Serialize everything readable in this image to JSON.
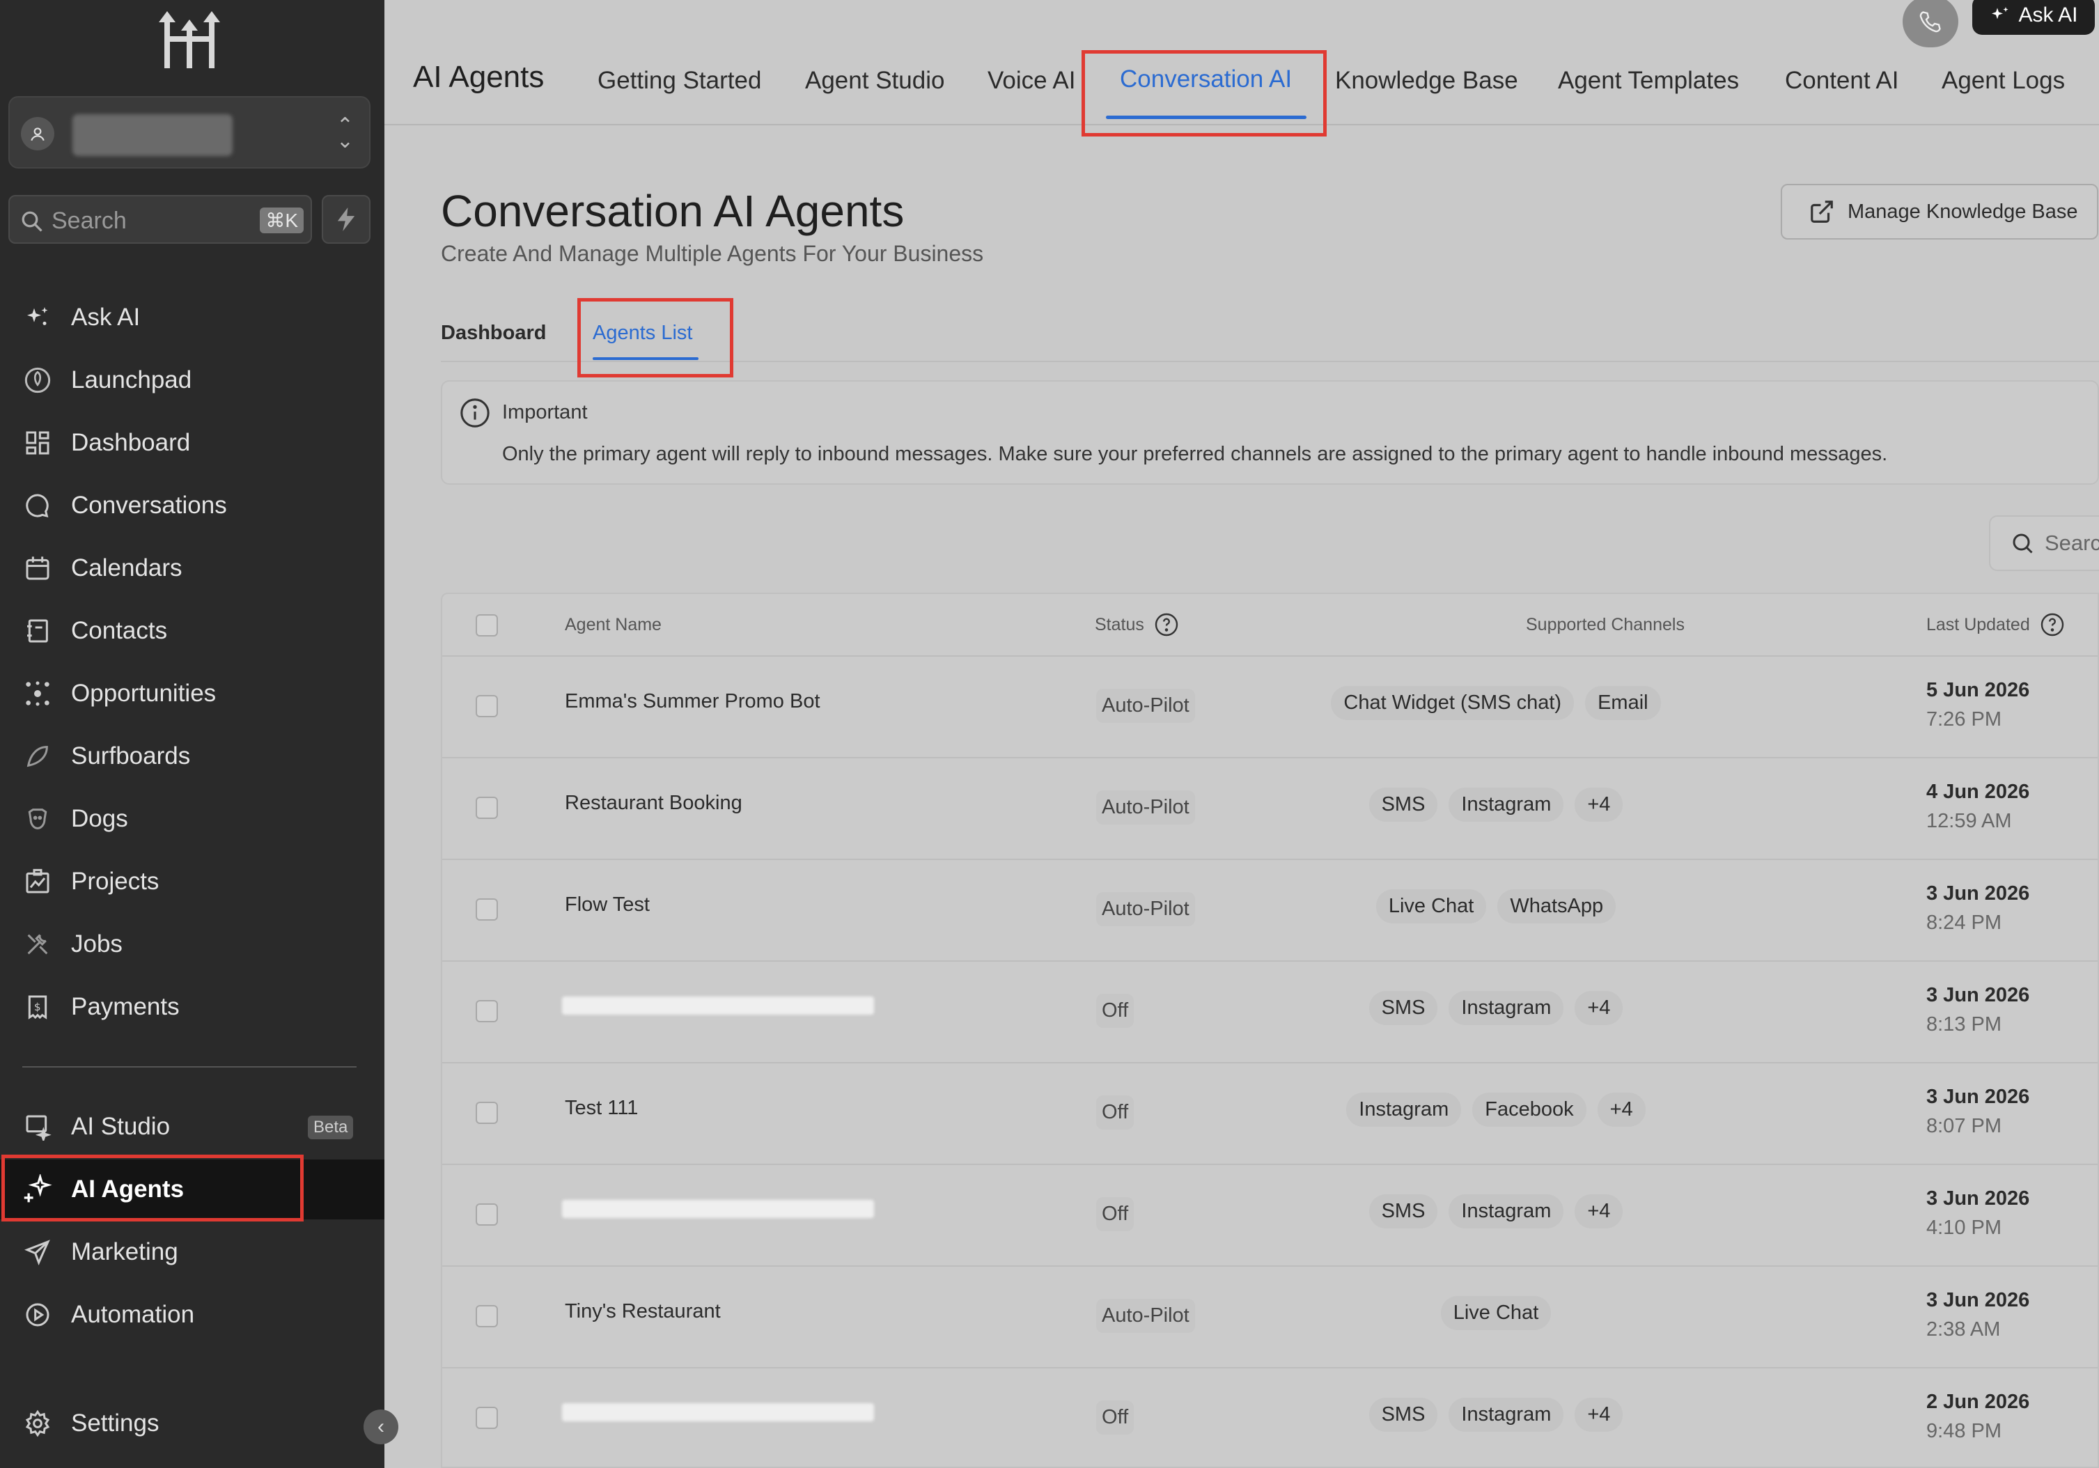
{
  "sidebar": {
    "search_placeholder": "Search",
    "search_shortcut": "⌘K",
    "items": [
      {
        "label": "Ask AI",
        "icon": "sparkle-icon"
      },
      {
        "label": "Launchpad",
        "icon": "rocket-icon"
      },
      {
        "label": "Dashboard",
        "icon": "dashboard-grid-icon"
      },
      {
        "label": "Conversations",
        "icon": "chat-bubble-icon"
      },
      {
        "label": "Calendars",
        "icon": "calendar-icon"
      },
      {
        "label": "Contacts",
        "icon": "contacts-book-icon"
      },
      {
        "label": "Opportunities",
        "icon": "opportunities-icon"
      },
      {
        "label": "Surfboards",
        "icon": "surfboard-icon"
      },
      {
        "label": "Dogs",
        "icon": "dog-icon"
      },
      {
        "label": "Projects",
        "icon": "projects-icon"
      },
      {
        "label": "Jobs",
        "icon": "tools-icon"
      },
      {
        "label": "Payments",
        "icon": "payments-icon"
      },
      {
        "label": "AI Studio",
        "icon": "ai-studio-icon"
      },
      {
        "label": "AI Agents",
        "icon": "ai-sparkle-icon"
      },
      {
        "label": "Marketing",
        "icon": "paper-plane-icon"
      },
      {
        "label": "Automation",
        "icon": "automation-icon"
      },
      {
        "label": "Settings",
        "icon": "gear-icon"
      }
    ],
    "beta_badge": "Beta",
    "active_item": "AI Agents"
  },
  "topbar": {
    "brand": "AI Agents",
    "tabs": [
      "Getting Started",
      "Agent Studio",
      "Voice AI",
      "Conversation AI",
      "Knowledge Base",
      "Agent Templates",
      "Content AI",
      "Agent Logs"
    ],
    "active_tab": "Conversation AI",
    "ask_ai_label": "Ask AI"
  },
  "main": {
    "title": "Conversation AI Agents",
    "subtitle": "Create And Manage Multiple Agents For Your Business",
    "manage_button": "Manage Knowledge Base",
    "subtabs": [
      "Dashboard",
      "Agents List"
    ],
    "active_subtab": "Agents List",
    "notice": {
      "title": "Important",
      "body": "Only the primary agent will reply to inbound messages. Make sure your preferred channels are assigned to the primary agent to handle inbound messages."
    },
    "table_search_placeholder": "Search"
  },
  "table": {
    "headers": {
      "name": "Agent Name",
      "status": "Status",
      "channels": "Supported Channels",
      "updated": "Last Updated"
    },
    "rows": [
      {
        "name": "Emma's Summer Promo Bot",
        "status": "Auto-Pilot",
        "channels": [
          "Chat Widget (SMS chat)",
          "Email"
        ],
        "date": "5 Jun 2026",
        "time": "7:26 PM"
      },
      {
        "name": "Restaurant Booking",
        "status": "Auto-Pilot",
        "channels": [
          "SMS",
          "Instagram",
          "+4"
        ],
        "date": "4 Jun 2026",
        "time": "12:59 AM"
      },
      {
        "name": "Flow Test",
        "status": "Auto-Pilot",
        "channels": [
          "Live Chat",
          "WhatsApp"
        ],
        "date": "3 Jun 2026",
        "time": "8:24 PM"
      },
      {
        "name": "",
        "status": "Off",
        "channels": [
          "SMS",
          "Instagram",
          "+4"
        ],
        "date": "3 Jun 2026",
        "time": "8:13 PM"
      },
      {
        "name": "Test 111",
        "status": "Off",
        "channels": [
          "Instagram",
          "Facebook",
          "+4"
        ],
        "date": "3 Jun 2026",
        "time": "8:07 PM"
      },
      {
        "name": "",
        "status": "Off",
        "channels": [
          "SMS",
          "Instagram",
          "+4"
        ],
        "date": "3 Jun 2026",
        "time": "4:10 PM"
      },
      {
        "name": "Tiny's Restaurant",
        "status": "Auto-Pilot",
        "channels": [
          "Live Chat"
        ],
        "date": "3 Jun 2026",
        "time": "2:38 AM"
      },
      {
        "name": "",
        "status": "Off",
        "channels": [
          "SMS",
          "Instagram",
          "+4"
        ],
        "date": "2 Jun 2026",
        "time": "9:48 PM"
      }
    ]
  },
  "colors": {
    "accent": "#2b6bd1",
    "highlight_box": "#e03a32",
    "sidebar_bg": "#2a2a2a"
  }
}
